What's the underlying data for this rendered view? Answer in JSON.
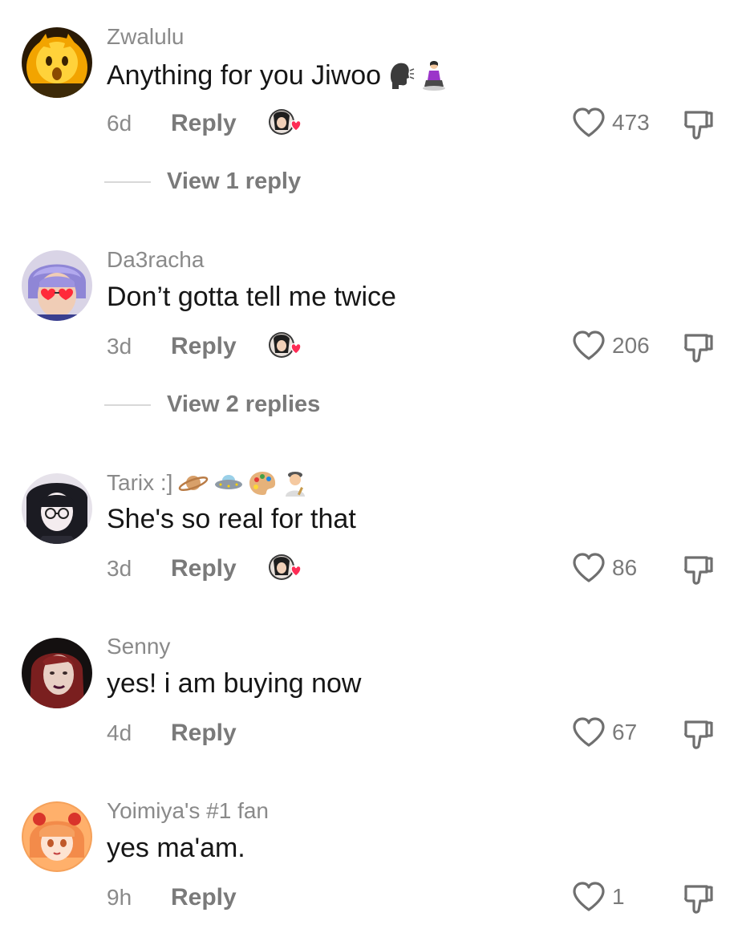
{
  "comments": [
    {
      "username": "Zwalulu",
      "text": "Anything for you Jiwoo",
      "text_emoji": [
        "speaking-head-icon",
        "kneeling-woman-icon"
      ],
      "time": "6d",
      "reply_label": "Reply",
      "creator_liked": true,
      "likes": "473",
      "view_replies": "View 1 reply",
      "avatar": "golden-cat-avatar"
    },
    {
      "username": "Da3racha",
      "text": "Don’t gotta tell me twice",
      "time": "3d",
      "reply_label": "Reply",
      "creator_liked": true,
      "likes": "206",
      "view_replies": "View 2 replies",
      "avatar": "purple-hair-heart-glasses-avatar"
    },
    {
      "username": "Tarix :]",
      "username_emoji": [
        "ringed-planet-icon",
        "flying-saucer-icon",
        "artist-palette-icon",
        "man-artist-icon"
      ],
      "text": "She's so real for that",
      "time": "3d",
      "reply_label": "Reply",
      "creator_liked": true,
      "likes": "86",
      "avatar": "anime-glasses-avatar"
    },
    {
      "username": "Senny",
      "text": "yes! i am buying now",
      "time": "4d",
      "reply_label": "Reply",
      "creator_liked": false,
      "likes": "67",
      "avatar": "red-hair-woman-avatar"
    },
    {
      "username": "Yoimiya's #1 fan",
      "text": "yes ma'am.",
      "time": "9h",
      "reply_label": "Reply",
      "creator_liked": false,
      "likes": "1",
      "avatar": "anime-orange-hair-avatar"
    }
  ],
  "colors": {
    "username": "#8a8a8a",
    "text": "#161616",
    "meta": "#7a7a7a",
    "heart_badge": "#fe2c55",
    "divider": "#d8d8d8"
  }
}
